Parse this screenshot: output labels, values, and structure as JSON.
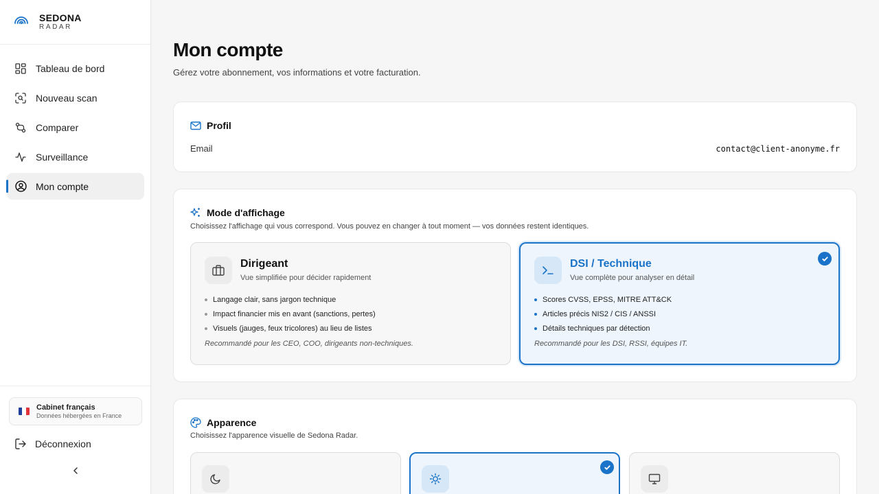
{
  "brand": {
    "name": "SEDONA",
    "sub": "RADAR"
  },
  "nav": [
    {
      "label": "Tableau de bord",
      "icon": "dashboard-icon"
    },
    {
      "label": "Nouveau scan",
      "icon": "scan-icon"
    },
    {
      "label": "Comparer",
      "icon": "compare-icon"
    },
    {
      "label": "Surveillance",
      "icon": "activity-icon"
    },
    {
      "label": "Mon compte",
      "icon": "user-circle-icon",
      "active": true
    }
  ],
  "sidebar_footer": {
    "cabinet_title": "Cabinet français",
    "cabinet_sub": "Données hébergées en France",
    "logout_label": "Déconnexion"
  },
  "page": {
    "title": "Mon compte",
    "subtitle": "Gérez votre abonnement, vos informations et votre facturation."
  },
  "profile": {
    "title": "Profil",
    "email_label": "Email",
    "email_value": "contact@client-anonyme.fr"
  },
  "display_mode": {
    "title": "Mode d'affichage",
    "description": "Choisissez l'affichage qui vous correspond. Vous pouvez en changer à tout moment — vos données restent identiques.",
    "options": [
      {
        "name": "Dirigeant",
        "tagline": "Vue simplifiée pour décider rapidement",
        "points": [
          "Langage clair, sans jargon technique",
          "Impact financier mis en avant (sanctions, pertes)",
          "Visuels (jauges, feux tricolores) au lieu de listes"
        ],
        "recommendation": "Recommandé pour les CEO, COO, dirigeants non-techniques.",
        "selected": false
      },
      {
        "name": "DSI / Technique",
        "tagline": "Vue complète pour analyser en détail",
        "points": [
          "Scores CVSS, EPSS, MITRE ATT&CK",
          "Articles précis NIS2 / CIS / ANSSI",
          "Détails techniques par détection"
        ],
        "recommendation": "Recommandé pour les DSI, RSSI, équipes IT.",
        "selected": true
      }
    ]
  },
  "appearance": {
    "title": "Apparence",
    "description": "Choisissez l'apparence visuelle de Sedona Radar.",
    "options": [
      {
        "icon": "moon-icon",
        "selected": false
      },
      {
        "icon": "sun-icon",
        "selected": true
      },
      {
        "icon": "monitor-icon",
        "selected": false
      }
    ]
  },
  "colors": {
    "accent": "#1a73c8",
    "flag_blue": "#1f3f9c",
    "flag_white": "#ffffff",
    "flag_red": "#e0343a"
  }
}
